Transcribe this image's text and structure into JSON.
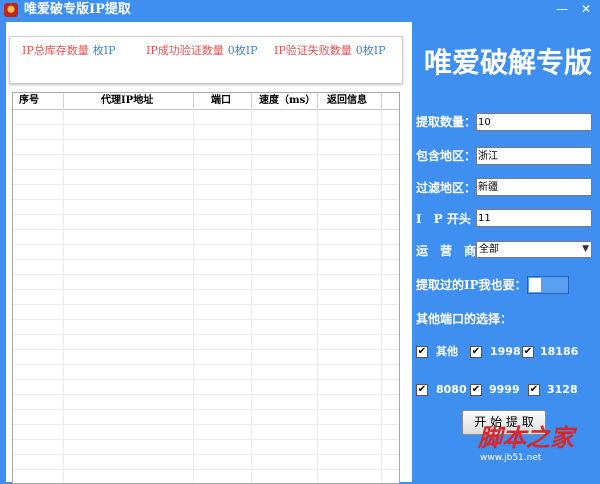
{
  "window": {
    "title": "唯爱破专版IP提取",
    "minimize": "—",
    "close": "✕"
  },
  "stats": [
    {
      "label": "IP总库存数量",
      "value": "枚IP"
    },
    {
      "label": "IP成功验证数量",
      "value": "0枚IP"
    },
    {
      "label": "IP验证失败数量",
      "value": "0枚IP"
    }
  ],
  "table": {
    "headers": [
      "序号",
      "代理IP地址",
      "端口",
      "速度（ms）",
      "返回信息"
    ],
    "rows": []
  },
  "brand": "唯爱破解专版",
  "form": {
    "count": {
      "label": "提取数量：",
      "value": "10"
    },
    "region_include": {
      "label": "包含地区：",
      "value": "浙江"
    },
    "region_filter": {
      "label": "过滤地区：",
      "value": "新疆"
    },
    "ip_prefix": {
      "label": "I　P 开头",
      "value": "11"
    },
    "isp": {
      "label": "运　营　商",
      "value": "全部"
    },
    "extracted_toggle": {
      "label": "提取过的IP我也要："
    },
    "ports_title": "其他端口的选择："
  },
  "ports": [
    {
      "label": "其他",
      "checked": true
    },
    {
      "label": "1998",
      "checked": true
    },
    {
      "label": "18186",
      "checked": true
    },
    {
      "label": "8080",
      "checked": true
    },
    {
      "label": "9999",
      "checked": true
    },
    {
      "label": "3128",
      "checked": true
    }
  ],
  "start_button": "开 始 提 取",
  "watermark": {
    "line1": "脚本之家",
    "line2": "www.jb51.net"
  },
  "check_glyph": "✔",
  "colors": {
    "background": "#3f8ff0",
    "stat_label": "#ee4e4e",
    "stat_value": "#3a82e0",
    "watermark": "#d9262a"
  }
}
